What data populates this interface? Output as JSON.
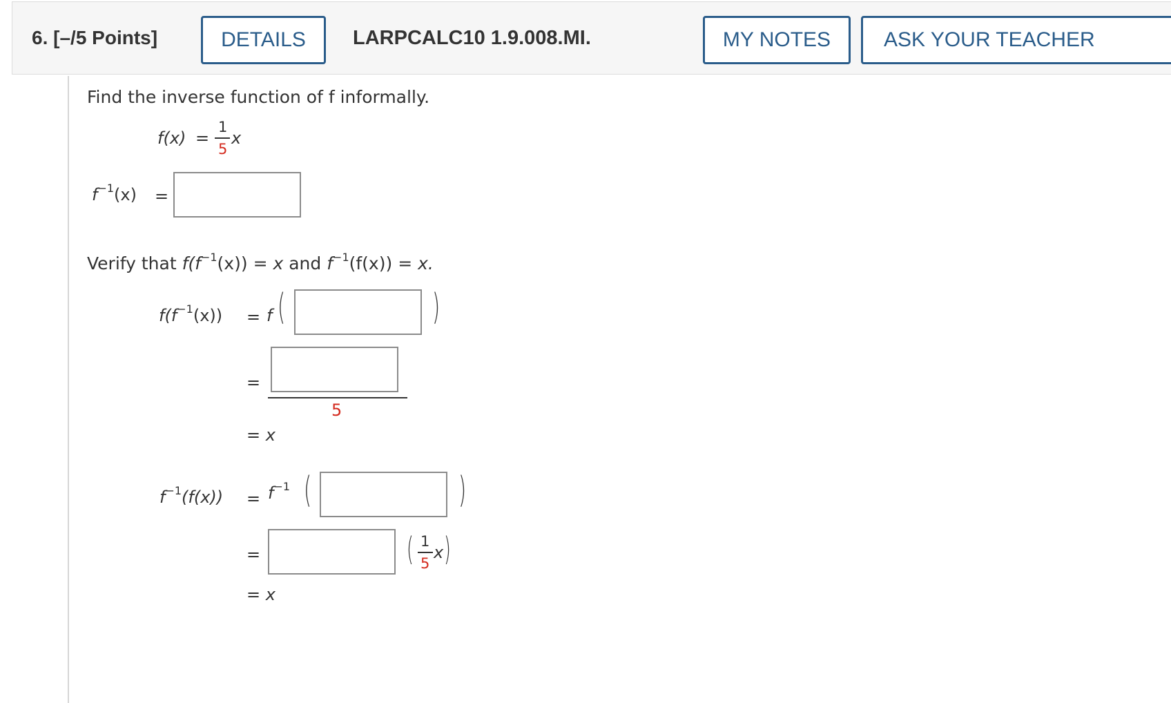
{
  "header": {
    "question_number": "6.",
    "points": "[–/5 Points]",
    "details_label": "DETAILS",
    "problem_code": "LARPCALC10 1.9.008.MI.",
    "my_notes_label": "MY NOTES",
    "ask_teacher_label": "ASK YOUR TEACHER"
  },
  "problem": {
    "instruction": "Find the inverse function of f informally.",
    "function_lhs": "f(x)",
    "equals": "=",
    "coef_num": "1",
    "coef_den": "5",
    "var": "x",
    "inverse_lhs_f": "f",
    "inverse_lhs_sup": "−1",
    "inverse_lhs_arg": "(x)",
    "verify_intro": "Verify that",
    "verify_expr1_a": "f(f",
    "verify_expr1_sup": "−1",
    "verify_expr1_b": "(x))",
    "verify_eq_x": "= x",
    "verify_and": "and",
    "verify_expr2_f": "f",
    "verify_expr2_sup": "−1",
    "verify_expr2_b": "(f(x))",
    "verify_end": "= x."
  },
  "step1": {
    "lhs_a": "f(f",
    "lhs_sup": "−1",
    "lhs_b": "(x))",
    "eq": "=",
    "outer_f": "f",
    "denominator": "5",
    "result": "= x"
  },
  "step2": {
    "lhs_f": "f",
    "lhs_sup": "−1",
    "lhs_b": "(f(x))",
    "eq": "=",
    "outer_f": "f",
    "outer_sup": "−1",
    "frac_num": "1",
    "frac_den": "5",
    "frac_var": "x",
    "result": "= x"
  },
  "inputs": {
    "inverse_answer": "",
    "step1_inner": "",
    "step1_numerator": "",
    "step2_inner": "",
    "step2_coef": ""
  },
  "colors": {
    "accent": "#2a5c8a",
    "highlight": "#d42a1e"
  }
}
